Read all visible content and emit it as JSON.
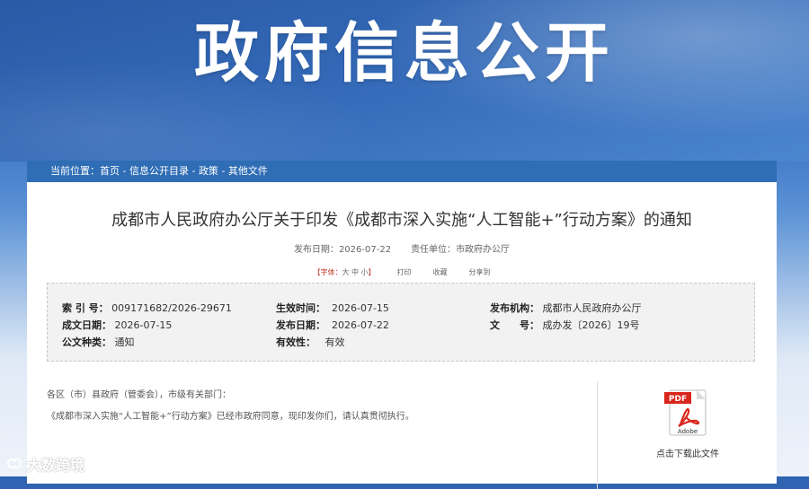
{
  "banner": {
    "title": "政府信息公开"
  },
  "breadcrumb": {
    "prefix": "当前位置：",
    "items": [
      "首页",
      "信息公开目录",
      "政策",
      "其他文件"
    ],
    "separator": " - "
  },
  "document": {
    "title": "成都市人民政府办公厅关于印发《成都市深入实施“人工智能+”行动方案》的通知",
    "publish_date_label": "发布日期：",
    "publish_date": "2026-07-22",
    "unit_label": "责任单位：",
    "unit": "市政府办公厅"
  },
  "tools": {
    "font_label": "【字体：",
    "large": "大",
    "medium": "中",
    "small": "小",
    "close_bracket": "】",
    "print": "打印",
    "favorite": "收藏",
    "share": "分享到"
  },
  "info": {
    "index_label": "索 引 号：",
    "index": "009171682/2026-29671",
    "effective_label": "生效时间：",
    "effective": "2026-07-15",
    "issuer_label": "发布机构：",
    "issuer": "成都市人民政府办公厅",
    "written_label": "成文日期：",
    "written": "2026-07-15",
    "published_label": "发布日期：",
    "published": "2026-07-22",
    "docno_label": "文　　号：",
    "docno": "成办发〔2026〕19号",
    "category_label": "公文种类：",
    "category": "通知",
    "validity_label": "有效性：",
    "validity": "有效"
  },
  "body": {
    "line1": "各区（市）县政府（管委会），市级有关部门：",
    "line2": "《成都市深入实施“人工智能+”行动方案》已经市政府同意，现印发你们，请认真贯彻执行。"
  },
  "download": {
    "pdf_badge": "PDF",
    "adobe": "Adobe",
    "caption": "点击下载此文件"
  },
  "watermark": {
    "text": "大数跨境"
  },
  "colors": {
    "accent": "#2f6db5",
    "pdf_red": "#d9261c"
  }
}
